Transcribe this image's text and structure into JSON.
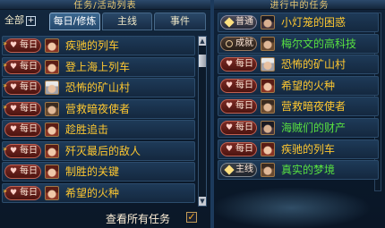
{
  "header": {
    "left_title_fragment": "任务/活动列表",
    "right_title_fragment": "进行中的任务"
  },
  "tabs": [
    {
      "label": "全部",
      "has_plus": true,
      "selected": false
    },
    {
      "label": "每日/修炼",
      "selected": true
    },
    {
      "label": "主线",
      "selected": false
    },
    {
      "label": "事件",
      "selected": false
    }
  ],
  "left_list": [
    {
      "badge": "每日",
      "name": "疾驰的列车",
      "new": true
    },
    {
      "badge": "每日",
      "name": "登上海上列车",
      "new": true
    },
    {
      "badge": "每日",
      "name": "恐怖的矿山村",
      "new": true
    },
    {
      "badge": "每日",
      "name": "营救暗夜使者",
      "new": true
    },
    {
      "badge": "每日",
      "name": "趁胜追击",
      "new": false
    },
    {
      "badge": "每日",
      "name": "歼灭最后的敌人",
      "new": true
    },
    {
      "badge": "每日",
      "name": "制胜的关键",
      "new": false
    },
    {
      "badge": "每日",
      "name": "希望的火种",
      "new": true
    }
  ],
  "right_list": [
    {
      "badge": "普通",
      "name": "小灯笼的困惑",
      "color": "yellow"
    },
    {
      "badge": "成就",
      "name": "梅尔文的高科技",
      "color": "green"
    },
    {
      "badge": "每日",
      "name": "恐怖的矿山村",
      "color": "yellow"
    },
    {
      "badge": "每日",
      "name": "希望的火种",
      "color": "yellow"
    },
    {
      "badge": "每日",
      "name": "营救暗夜使者",
      "color": "yellow"
    },
    {
      "badge": "每日",
      "name": "海贼们的财产",
      "color": "green"
    },
    {
      "badge": "每日",
      "name": "疾驰的列车",
      "color": "yellow"
    },
    {
      "badge": "主线",
      "name": "真实的梦境",
      "color": "green"
    }
  ],
  "footer": {
    "view_all_label": "查看所有任务",
    "view_all_checked": true
  },
  "icons": {
    "badge_daily": "heart-icon",
    "badge_normal": "diamond-icon",
    "badge_achievement": "ring-icon",
    "badge_main": "diamond-icon",
    "new_marker": "double-chevron-icon"
  },
  "colors": {
    "quest_yellow": "#ffc830",
    "quest_green": "#58e040",
    "selected_tab": "#3c6890"
  }
}
